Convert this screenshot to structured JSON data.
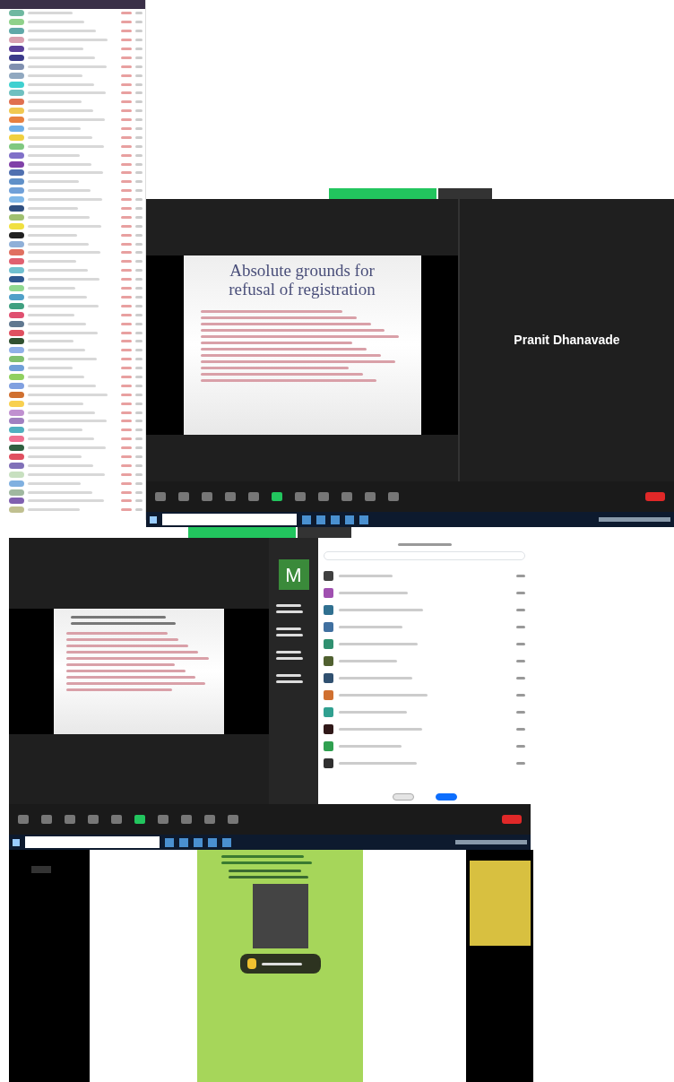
{
  "screenshots": [
    {
      "kind": "attendance-sheet",
      "rows": [
        {
          "color": "#6fb8a0"
        },
        {
          "color": "#8fd18a"
        },
        {
          "color": "#5fa8a8"
        },
        {
          "color": "#d9a0b0"
        },
        {
          "color": "#5a3f9a"
        },
        {
          "color": "#3a3a8a"
        },
        {
          "color": "#8090b0"
        },
        {
          "color": "#90a8c0"
        },
        {
          "color": "#40d0d0"
        },
        {
          "color": "#70c0c0"
        },
        {
          "color": "#e07050"
        },
        {
          "color": "#f0c850"
        },
        {
          "color": "#e88040"
        },
        {
          "color": "#70b0e8"
        },
        {
          "color": "#f0d040"
        },
        {
          "color": "#80c880"
        },
        {
          "color": "#8070c8"
        },
        {
          "color": "#8040a8"
        },
        {
          "color": "#5070b0"
        },
        {
          "color": "#6090c8"
        },
        {
          "color": "#70a0d8"
        },
        {
          "color": "#80b8e8"
        },
        {
          "color": "#305080"
        },
        {
          "color": "#a0c070"
        },
        {
          "color": "#f0e040"
        },
        {
          "color": "#202020"
        },
        {
          "color": "#90b0d8"
        },
        {
          "color": "#e07060"
        },
        {
          "color": "#e06070"
        },
        {
          "color": "#70c0d0"
        },
        {
          "color": "#305890"
        },
        {
          "color": "#90d890"
        },
        {
          "color": "#50a0c8"
        },
        {
          "color": "#40a080"
        },
        {
          "color": "#e05070"
        },
        {
          "color": "#607890"
        },
        {
          "color": "#e05060"
        },
        {
          "color": "#305030"
        },
        {
          "color": "#90b0e8"
        },
        {
          "color": "#80c070"
        },
        {
          "color": "#70a0d8"
        },
        {
          "color": "#90d060"
        },
        {
          "color": "#80a0e0"
        },
        {
          "color": "#d07030"
        },
        {
          "color": "#f8d050"
        },
        {
          "color": "#c090d0"
        },
        {
          "color": "#a080c0"
        },
        {
          "color": "#50b0c0"
        },
        {
          "color": "#f07090"
        },
        {
          "color": "#306040"
        },
        {
          "color": "#e05060"
        },
        {
          "color": "#8070b8"
        },
        {
          "color": "#c8e0c0"
        },
        {
          "color": "#80b0e0"
        },
        {
          "color": "#a0b8a0"
        },
        {
          "color": "#8060b0"
        },
        {
          "color": "#c0c090"
        }
      ]
    },
    {
      "kind": "meeting-share",
      "slide_title": "Absolute grounds for refusal of registration",
      "speaker": "Pranit Dhanavade"
    },
    {
      "kind": "meeting-gallery",
      "tile_initial": "M",
      "participants": [
        {
          "color": "#404040"
        },
        {
          "color": "#a050b0"
        },
        {
          "color": "#307090"
        },
        {
          "color": "#4070a0"
        },
        {
          "color": "#309070"
        },
        {
          "color": "#506030"
        },
        {
          "color": "#305070"
        },
        {
          "color": "#d07030"
        },
        {
          "color": "#30a090"
        },
        {
          "color": "#301818"
        },
        {
          "color": "#30a050"
        },
        {
          "color": "#303030"
        }
      ]
    },
    {
      "kind": "meeting-poster"
    }
  ]
}
